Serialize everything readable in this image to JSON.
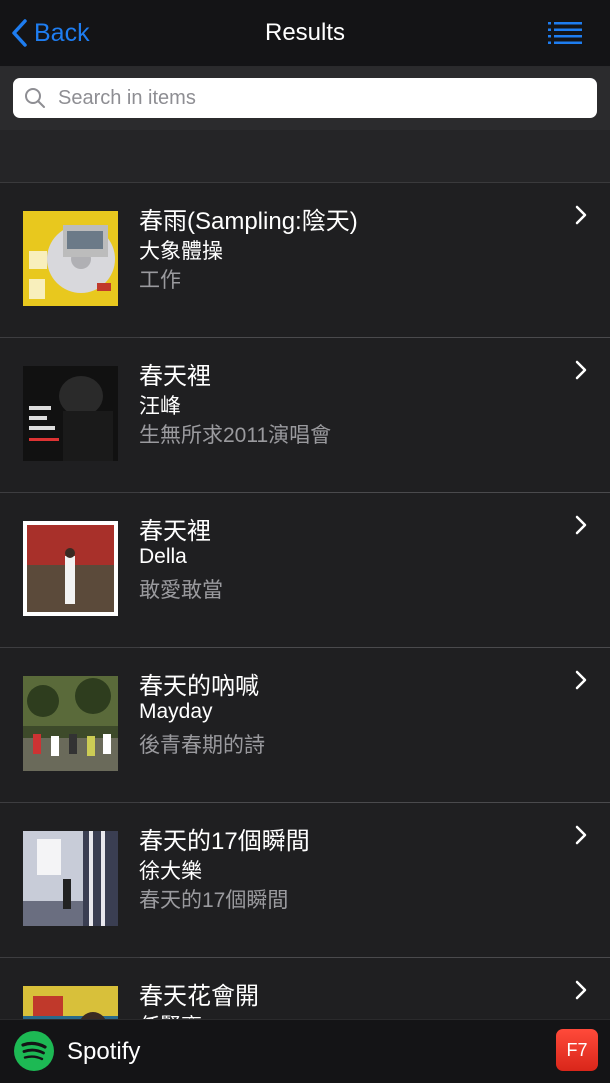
{
  "nav": {
    "back_label": "Back",
    "title": "Results"
  },
  "search": {
    "placeholder": "Search in items"
  },
  "items": [
    {
      "title": "春雨(Sampling:陰天)",
      "artist": "大象體操",
      "album": "工作"
    },
    {
      "title": "春天裡",
      "artist": "汪峰",
      "album": "生無所求2011演唱會"
    },
    {
      "title": "春天裡",
      "artist": "Della",
      "album": "敢愛敢當"
    },
    {
      "title": "春天的吶喊",
      "artist": "Mayday",
      "album": "後青春期的詩"
    },
    {
      "title": "春天的17個瞬間",
      "artist": "徐大樂",
      "album": "春天的17個瞬間"
    },
    {
      "title": "春天花會開",
      "artist": "任賢齊",
      "album": ""
    }
  ],
  "footer": {
    "service": "Spotify",
    "badge": "F7"
  },
  "colors": {
    "accent": "#1e7df0",
    "spotify": "#1db954",
    "badge": "#e53a2c"
  }
}
